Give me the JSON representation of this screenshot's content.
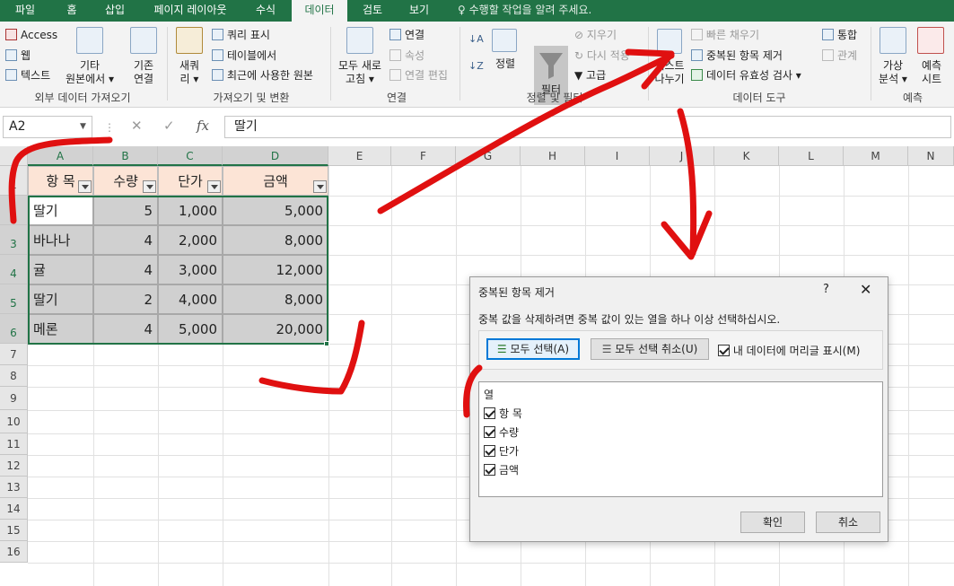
{
  "menu": {
    "tabs": [
      "파일",
      "홈",
      "삽입",
      "페이지 레이아웃",
      "수식",
      "데이터",
      "검토",
      "보기"
    ],
    "active": "데이터",
    "tell_me": "수행할 작업을 알려 주세요."
  },
  "ribbon": {
    "external": {
      "access": "Access",
      "web": "웹",
      "text": "텍스트",
      "other_line1": "기타",
      "other_line2": "원본에서 ▾",
      "existing_line1": "기존",
      "existing_line2": "연결",
      "label": "외부 데이터 가져오기"
    },
    "get_transform": {
      "new_query_line1": "새쿼",
      "new_query_line2": "리 ▾",
      "show_query": "쿼리 표시",
      "from_table": "테이블에서",
      "recent": "최근에 사용한 원본",
      "label": "가져오기 및 변환"
    },
    "connections": {
      "refresh_line1": "모두 새로",
      "refresh_line2": "고침 ▾",
      "connections": "연결",
      "properties": "속성",
      "edit_links": "연결 편집",
      "label": "연결"
    },
    "sort_filter": {
      "sort": "정렬",
      "filter": "필터",
      "clear": "지우기",
      "reapply": "다시 적용",
      "advanced": "고급",
      "label": "정렬 및 필터"
    },
    "data_tools": {
      "text_to_cols_line1": "텍스트",
      "text_to_cols_line2": "나누기",
      "flash_fill": "빠른 채우기",
      "remove_dup": "중복된 항목 제거",
      "validation": "데이터 유효성 검사 ▾",
      "consolidate": "통합",
      "relationships": "관계",
      "label": "데이터 도구"
    },
    "forecast": {
      "whatif_line1": "가상",
      "whatif_line2": "분석 ▾",
      "sheet_line1": "예측",
      "sheet_line2": "시트",
      "label": "예측"
    }
  },
  "formula_bar": {
    "name_box": "A2",
    "cancel": "✕",
    "enter": "✓",
    "fx": "fx",
    "value": "딸기"
  },
  "sheet": {
    "columns": [
      "A",
      "B",
      "C",
      "D",
      "E",
      "F",
      "G",
      "H",
      "I",
      "J",
      "K",
      "L",
      "M",
      "N"
    ],
    "rows": [
      "1",
      "2",
      "3",
      "4",
      "5",
      "6",
      "7",
      "8",
      "9",
      "10",
      "11",
      "12",
      "13",
      "14",
      "15",
      "16"
    ],
    "table_headers": [
      "항 목",
      "수량",
      "단가",
      "금액"
    ],
    "table_rows": [
      [
        "딸기",
        "5",
        "1,000",
        "5,000"
      ],
      [
        "바나나",
        "4",
        "2,000",
        "8,000"
      ],
      [
        "귤",
        "4",
        "3,000",
        "12,000"
      ],
      [
        "딸기",
        "2",
        "4,000",
        "8,000"
      ],
      [
        "메론",
        "4",
        "5,000",
        "20,000"
      ]
    ]
  },
  "dialog": {
    "title": "중복된 항목 제거",
    "help": "?",
    "close": "✕",
    "instruction": "중복 값을 삭제하려면 중복 값이 있는 열을 하나 이상 선택하십시오.",
    "select_all": "모두 선택(A)",
    "unselect_all": "모두 선택 취소(U)",
    "has_headers": "내 데이터에 머리글 표시(M)",
    "has_headers_checked": true,
    "list_header": "열",
    "columns": [
      {
        "label": "항 목",
        "checked": true
      },
      {
        "label": "수량",
        "checked": true
      },
      {
        "label": "단가",
        "checked": true
      },
      {
        "label": "금액",
        "checked": true
      }
    ],
    "ok": "확인",
    "cancel": "취소"
  },
  "colors": {
    "excel_green": "#217346",
    "annotation_red": "#e01010",
    "header_fill": "#fce4d6",
    "selection_fill": "#d0d0d0"
  }
}
